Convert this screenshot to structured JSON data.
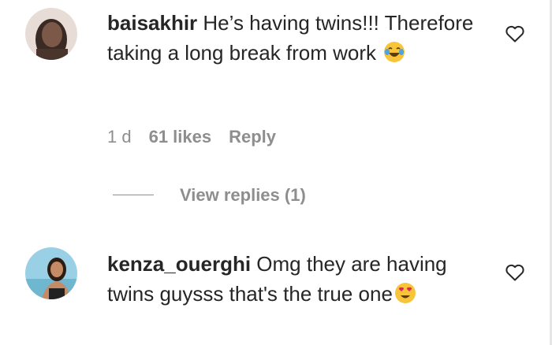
{
  "comments": [
    {
      "username": "baisakhir",
      "text": " He’s having twins!!! Therefore taking a long break from work ",
      "emoji": "face-with-tears-of-joy",
      "time": "1 d",
      "likes": "61 likes",
      "reply_label": "Reply",
      "view_replies": "View replies (1)"
    },
    {
      "username": "kenza_ouerghi",
      "text": " Omg they are having twins guysss that's the true one",
      "emoji": "smiling-face-with-heart-eyes"
    }
  ],
  "colors": {
    "text": "#262626",
    "muted": "#8e8e8e",
    "emoji_yellow": "#f7c43a",
    "heart_red": "#e0245e"
  }
}
